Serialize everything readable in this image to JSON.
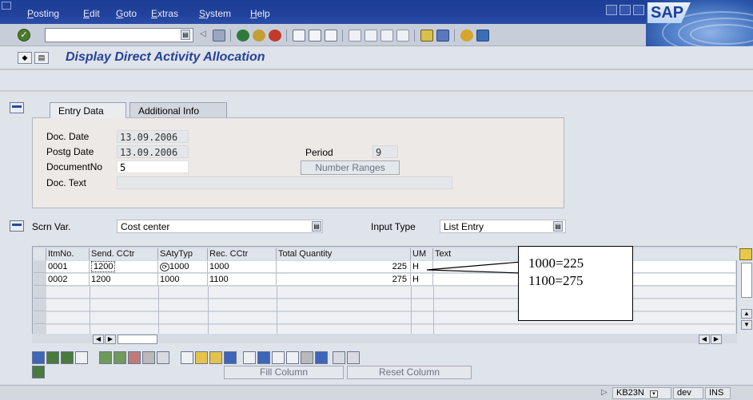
{
  "menubar": {
    "items": [
      "Posting",
      "Edit",
      "Goto",
      "Extras",
      "System",
      "Help"
    ],
    "logo": "SAP"
  },
  "title": "Display Direct Activity Allocation",
  "tabs": [
    "Entry Data",
    "Additional Info"
  ],
  "entry": {
    "doc_date_label": "Doc. Date",
    "doc_date": "13.09.2006",
    "postg_date_label": "Postg Date",
    "postg_date": "13.09.2006",
    "docno_label": "DocumentNo",
    "docno": "5",
    "doc_text_label": "Doc. Text",
    "doc_text": "",
    "period_label": "Period",
    "period": "9",
    "number_ranges": "Number Ranges"
  },
  "screen": {
    "scrn_var_label": "Scrn Var.",
    "scrn_var_value": "Cost center",
    "input_type_label": "Input Type",
    "input_type_value": "List Entry"
  },
  "table": {
    "headers": [
      "ItmNo.",
      "Send. CCtr",
      "SAtyTyp",
      "Rec. CCtr",
      "Total Quantity",
      "UM",
      "Text"
    ],
    "rows": [
      {
        "itm": "0001",
        "send": "1200",
        "satytyp": "1000",
        "rec": "1000",
        "qty": "225",
        "um": "H",
        "text": ""
      },
      {
        "itm": "0002",
        "send": "1200",
        "satytyp": "1000",
        "rec": "1100",
        "qty": "275",
        "um": "H",
        "text": ""
      }
    ]
  },
  "callout": {
    "line1": "1000=225",
    "line2": "1100=275"
  },
  "buttons": {
    "fill_column": "Fill Column",
    "reset_column": "Reset Column"
  },
  "status": {
    "tcode": "KB23N",
    "system": "dev",
    "mode": "INS"
  },
  "colors": {
    "menubar": "#21419b",
    "title": "#26439a",
    "body": "#dfe3ea"
  }
}
